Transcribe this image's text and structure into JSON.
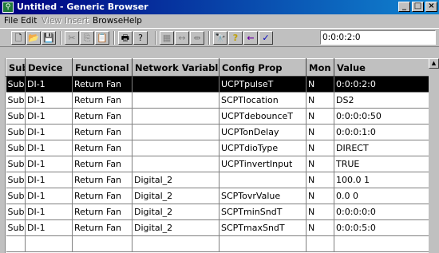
{
  "window": {
    "title": "Untitled - Generic Browser",
    "icon": "app-network-icon",
    "buttons": [
      "minimize",
      "maximize",
      "close"
    ]
  },
  "menu": {
    "items": [
      {
        "label": "File",
        "enabled": true
      },
      {
        "label": "Edit",
        "enabled": true
      },
      {
        "label": "View",
        "enabled": false
      },
      {
        "label": "Insert",
        "enabled": false
      },
      {
        "label": "Browse",
        "enabled": true
      },
      {
        "label": "Help",
        "enabled": true
      }
    ]
  },
  "toolbar": {
    "buttons": [
      {
        "icon": "new-document-icon",
        "glyph": "🗋",
        "enabled": true
      },
      {
        "icon": "open-folder-icon",
        "glyph": "📂",
        "enabled": true
      },
      {
        "icon": "save-icon",
        "glyph": "💾",
        "enabled": true
      },
      {
        "icon": "cut-icon",
        "glyph": "✂",
        "enabled": false
      },
      {
        "icon": "copy-icon",
        "glyph": "⎘",
        "enabled": false
      },
      {
        "icon": "paste-icon",
        "glyph": "📋",
        "enabled": false
      },
      {
        "icon": "print-icon",
        "glyph": "🖶",
        "enabled": true
      },
      {
        "icon": "help-icon",
        "glyph": "?",
        "enabled": true
      },
      {
        "icon": "grid-icon",
        "glyph": "▦",
        "enabled": false
      },
      {
        "icon": "fit-columns-icon",
        "glyph": "↔",
        "enabled": false
      },
      {
        "icon": "shrink-columns-icon",
        "glyph": "⇹",
        "enabled": false
      },
      {
        "icon": "binoculars-icon",
        "glyph": "🔭",
        "enabled": true
      },
      {
        "icon": "query-icon",
        "glyph": "?",
        "enabled": true
      },
      {
        "icon": "back-arrow-icon",
        "glyph": "←",
        "enabled": true
      },
      {
        "icon": "checkmark-icon",
        "glyph": "✓",
        "enabled": true
      }
    ],
    "value_field": "0:0:0:2:0"
  },
  "table": {
    "columns": [
      "Sub",
      "Device",
      "Functional B",
      "Network Variable",
      "Config Prop",
      "Mon",
      "Value"
    ],
    "selected_row": 0,
    "rows": [
      [
        "Sub",
        "DI-1",
        "Return Fan",
        "",
        "UCPTpulseT",
        "N",
        "0:0:0:2:0"
      ],
      [
        "Sub",
        "DI-1",
        "Return Fan",
        "",
        "SCPTlocation",
        "N",
        "DS2"
      ],
      [
        "Sub",
        "DI-1",
        "Return Fan",
        "",
        "UCPTdebounceT",
        "N",
        "0:0:0:0:50"
      ],
      [
        "Sub",
        "DI-1",
        "Return Fan",
        "",
        "UCPTonDelay",
        "N",
        "0:0:0:1:0"
      ],
      [
        "Sub",
        "DI-1",
        "Return Fan",
        "",
        "UCPTdioType",
        "N",
        "DIRECT"
      ],
      [
        "Sub",
        "DI-1",
        "Return Fan",
        "",
        "UCPTinvertInput",
        "N",
        "TRUE"
      ],
      [
        "Sub",
        "DI-1",
        "Return Fan",
        "Digital_2",
        "",
        "N",
        "100.0 1"
      ],
      [
        "Sub",
        "DI-1",
        "Return Fan",
        "Digital_2",
        "SCPTovrValue",
        "N",
        "0.0 0"
      ],
      [
        "Sub",
        "DI-1",
        "Return Fan",
        "Digital_2",
        "SCPTminSndT",
        "N",
        "0:0:0:0:0"
      ],
      [
        "Sub",
        "DI-1",
        "Return Fan",
        "Digital_2",
        "SCPTmaxSndT",
        "N",
        "0:0:0:5:0"
      ],
      [
        "",
        "",
        "",
        "",
        "",
        "",
        ""
      ]
    ]
  },
  "colors": {
    "titlebar_start": "#000080",
    "titlebar_end": "#1084d0",
    "selection": "#000000",
    "chrome": "#c0c0c0"
  }
}
